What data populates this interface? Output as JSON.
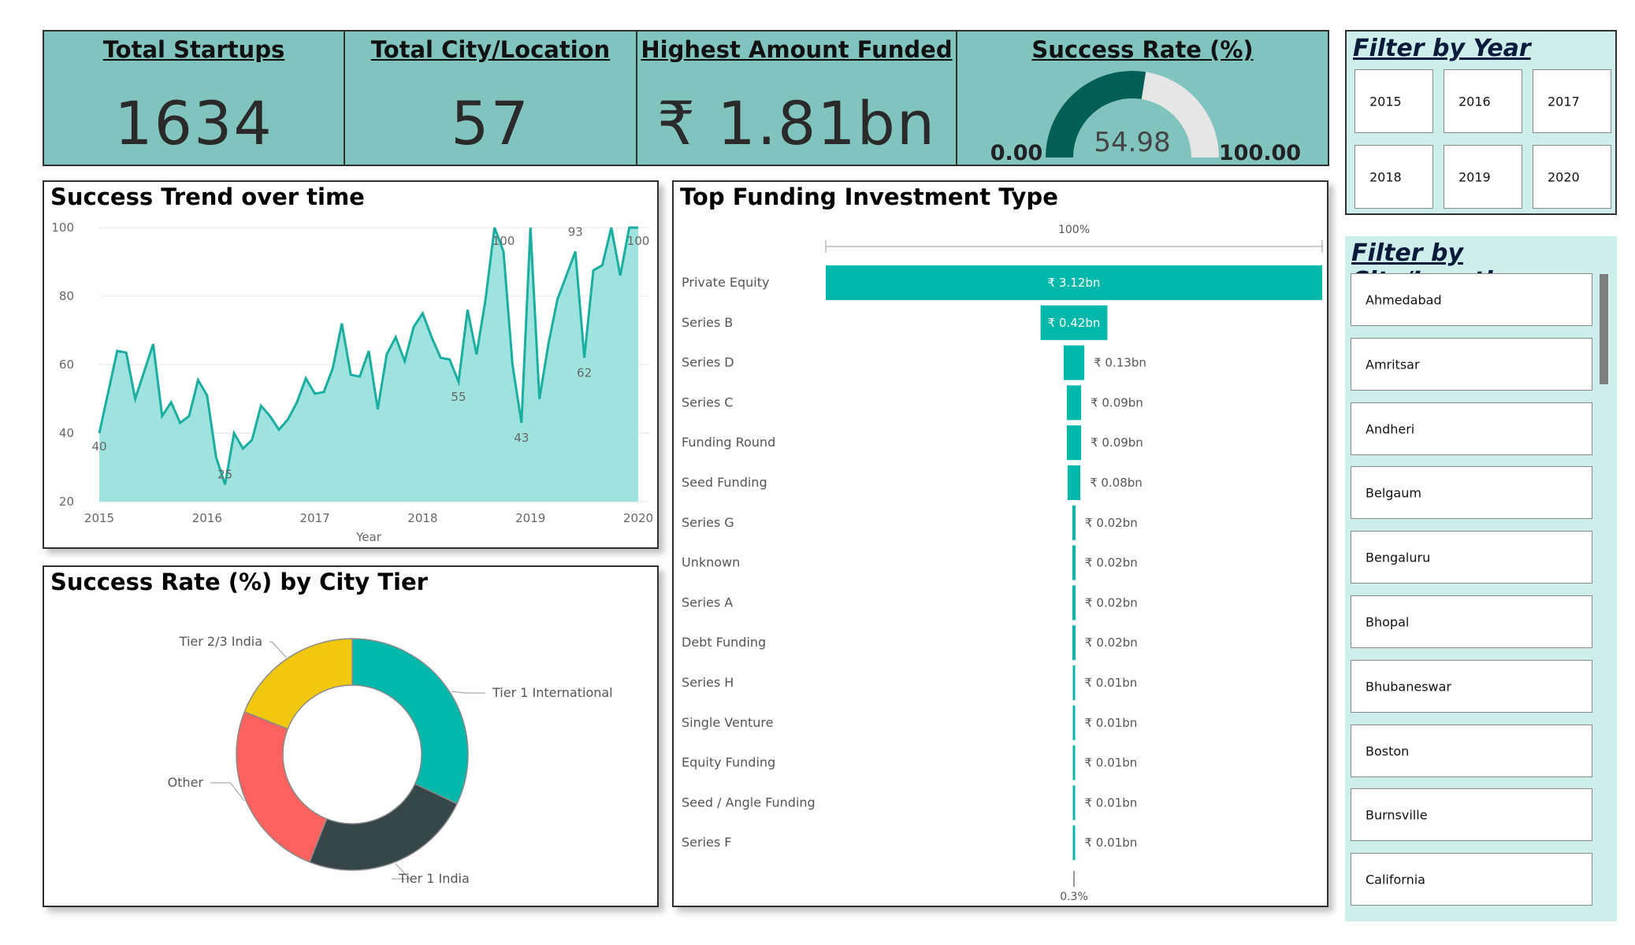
{
  "kpis": {
    "total_startups": {
      "title": "Total Startups",
      "value": "1634"
    },
    "total_city": {
      "title": "Total City/Location",
      "value": "57"
    },
    "highest_funded": {
      "title": "Highest Amount Funded",
      "value": "₹ 1.81bn"
    },
    "success_rate": {
      "title": "Success Rate (%)",
      "value": "54.98",
      "min": "0.00",
      "max": "100.00"
    }
  },
  "filters": {
    "year": {
      "title": "Filter by Year",
      "options": [
        "2015",
        "2016",
        "2017",
        "2018",
        "2019",
        "2020"
      ]
    },
    "city": {
      "title": "Filter by City/Location",
      "options": [
        "Ahmedabad",
        "Amritsar",
        "Andheri",
        "Belgaum",
        "Bengaluru",
        "Bhopal",
        "Bhubaneswar",
        "Boston",
        "Burnsville",
        "California"
      ]
    }
  },
  "colors": {
    "kpi_bg": "#80c4bd",
    "teal": "#01b8aa",
    "gauge_fill": "#015f55",
    "gauge_track": "#e6e6e6",
    "slicer_bg": "#cdeeeb"
  },
  "chart_data": [
    {
      "id": "trend",
      "type": "area",
      "title": "Success Trend over time",
      "xlabel": "Year",
      "ylabel": "",
      "x_ticks": [
        "2015",
        "2016",
        "2017",
        "2018",
        "2019",
        "2020"
      ],
      "xlim": [
        2015,
        2020
      ],
      "ylim": [
        20,
        100
      ],
      "y_ticks": [
        20,
        40,
        60,
        80,
        100
      ],
      "grid": true,
      "series": [
        {
          "x": [
            2015.0,
            2015.083,
            2015.167,
            2015.25,
            2015.333,
            2015.417,
            2015.5,
            2015.583,
            2015.667,
            2015.75,
            2015.833,
            2015.917,
            2016.0,
            2016.083,
            2016.167,
            2016.25,
            2016.333,
            2016.417,
            2016.5,
            2016.583,
            2016.667,
            2016.75,
            2016.833,
            2016.917,
            2017.0,
            2017.083,
            2017.167,
            2017.25,
            2017.333,
            2017.417,
            2017.5,
            2017.583,
            2017.667,
            2017.75,
            2017.833,
            2017.917,
            2018.0,
            2018.083,
            2018.167,
            2018.25,
            2018.333,
            2018.417,
            2018.5,
            2018.583,
            2018.667,
            2018.75,
            2018.833,
            2018.917,
            2019.0,
            2019.083,
            2019.167,
            2019.25,
            2019.333,
            2019.417,
            2019.5,
            2019.583,
            2019.667,
            2019.75,
            2019.833,
            2019.917,
            2020.0
          ],
          "values": [
            40,
            52,
            64,
            63.5,
            50,
            58,
            66,
            45,
            49,
            43,
            45,
            55.5,
            51,
            33,
            25,
            40,
            35.5,
            38,
            48,
            45,
            41,
            44,
            49,
            56,
            51.5,
            52,
            59,
            72,
            57,
            56.5,
            64,
            47,
            63,
            68,
            61,
            71,
            75,
            68,
            62,
            61.5,
            55,
            76,
            63,
            79,
            100,
            93,
            60,
            43,
            100,
            50,
            66,
            79,
            86,
            93,
            62,
            87.5,
            89,
            100,
            86,
            100,
            100
          ]
        }
      ],
      "data_labels": [
        {
          "x": 2015.0,
          "y": 40,
          "text": "40"
        },
        {
          "x": 2016.167,
          "y": 25,
          "text": "25"
        },
        {
          "x": 2018.333,
          "y": 55,
          "text": "55"
        },
        {
          "x": 2018.75,
          "y": 100,
          "text": "100"
        },
        {
          "x": 2018.917,
          "y": 43,
          "text": "43"
        },
        {
          "x": 2019.417,
          "y": 93,
          "text": "93"
        },
        {
          "x": 2019.5,
          "y": 62,
          "text": "62"
        },
        {
          "x": 2020.0,
          "y": 100,
          "text": "100"
        }
      ]
    },
    {
      "id": "funnel",
      "type": "bar",
      "title": "Top Funding Investment Type",
      "top_label": "100%",
      "bottom_label": "0.3%",
      "categories": [
        "Private Equity",
        "Series B",
        "Series D",
        "Series C",
        "Funding Round",
        "Seed Funding",
        "Series G",
        "Unknown",
        "Series A",
        "Debt Funding",
        "Series H",
        "Single Venture",
        "Equity Funding",
        "Seed / Angle Funding",
        "Series F"
      ],
      "values": [
        3.12,
        0.42,
        0.13,
        0.09,
        0.09,
        0.08,
        0.02,
        0.02,
        0.02,
        0.02,
        0.01,
        0.01,
        0.01,
        0.01,
        0.01
      ],
      "labels": [
        "₹ 3.12bn",
        "₹ 0.42bn",
        "₹ 0.13bn",
        "₹ 0.09bn",
        "₹ 0.09bn",
        "₹ 0.08bn",
        "₹ 0.02bn",
        "₹ 0.02bn",
        "₹ 0.02bn",
        "₹ 0.02bn",
        "₹ 0.01bn",
        "₹ 0.01bn",
        "₹ 0.01bn",
        "₹ 0.01bn",
        "₹ 0.01bn"
      ],
      "color": "#01b8aa"
    },
    {
      "id": "donut",
      "type": "pie",
      "title": "Success Rate (%) by City Tier",
      "slices": [
        {
          "label": "Tier 1 International",
          "value": 32,
          "color": "#01b8aa"
        },
        {
          "label": "Tier 1 India",
          "value": 24,
          "color": "#374649"
        },
        {
          "label": "Other",
          "value": 25,
          "color": "#fd625e"
        },
        {
          "label": "Tier 2/3 India",
          "value": 19,
          "color": "#f2c80f"
        }
      ]
    }
  ]
}
